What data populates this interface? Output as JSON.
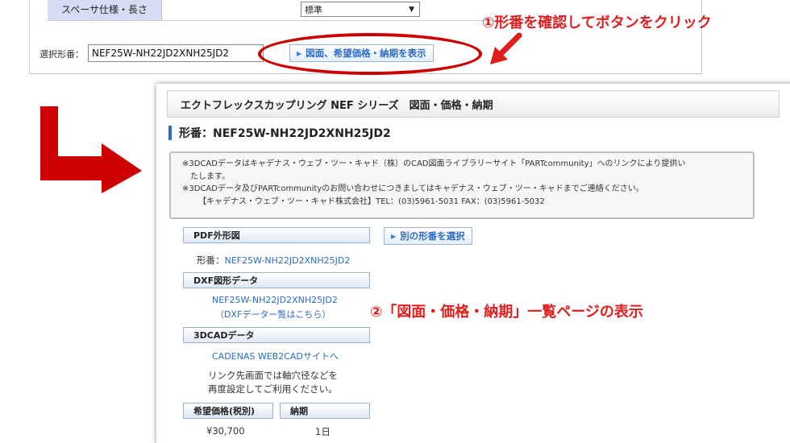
{
  "form": {
    "spec_label": "スペーサ仕様・長さ",
    "spec_value": "標準",
    "selected_label": "選択形番：",
    "selected_value": "NEF25W-NH22JD2XNH25JD2",
    "show_button": "図面、希望価格・納期を表示"
  },
  "annotations": {
    "step1": "①形番を確認してボタンをクリック",
    "step2": "②「図面・価格・納期」一覧ページの表示",
    "highlight_color": "#cc0000"
  },
  "result": {
    "series_title": "エクトフレックスカップリング NEF シリーズ　図面・価格・納期",
    "model_heading": "形番：NEF25W-NH22JD2XNH25JD2",
    "notice": {
      "line1": "※3DCADデータはキャデナス・ウェブ・ツー・キャド（株）のCAD図面ライブラリーサイト「PARTcommunity」へのリンクにより提供い",
      "line2": "たします。",
      "line3": "※3DCADデータ及びPARTcommunityのお問い合わせにつきましてはキャデナス・ウェブ・ツー・キャドまでご連絡ください。",
      "line4": "【キャデナス・ウェブ・ツー・キャド株式会社】TEL：(03)5961-5031 FAX：(03)5961-5032"
    },
    "pdf": {
      "head": "PDF外形図",
      "model_label": "形番：",
      "model_link": "NEF25W-NH22JD2XNH25JD2"
    },
    "other_model_button": "別の形番を選択",
    "dxf": {
      "head": "DXF図形データ",
      "link": "NEF25W-NH22JD2XNH25JD2",
      "list_link": "（DXFデーター覧はこちら）"
    },
    "cad3d": {
      "head": "3DCADデータ",
      "link": "CADENAS WEB2CADサイトへ",
      "note1": "リンク先画面では軸穴径などを",
      "note2": "再度設定してご利用ください。"
    },
    "price": {
      "price_head": "希望価格(税別)",
      "delivery_head": "納期",
      "price_value": "¥30,700",
      "delivery_value": "1日"
    },
    "accent_color": "#2a6cc8"
  }
}
